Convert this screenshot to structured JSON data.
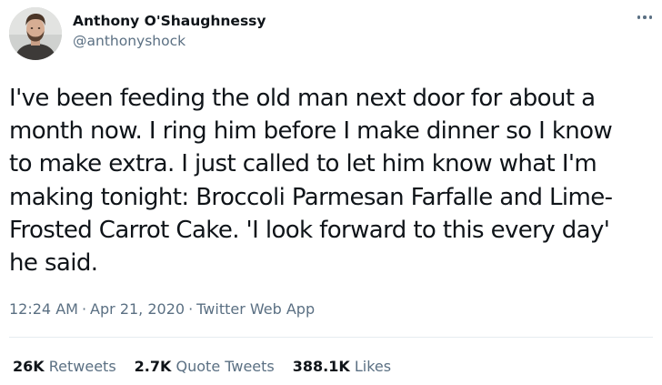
{
  "author": {
    "display_name": "Anthony O'Shaughnessy",
    "handle": "@anthonyshock",
    "avatar_icon": "profile-photo-avatar"
  },
  "more_icon": "more-options-icon",
  "tweet": {
    "lines": [
      "I've been feeding the old man next door for about a",
      "month now. I ring him before I make dinner so I know",
      "to make extra. I just called to let him know what I'm",
      "making tonight: Broccoli Parmesan Farfalle and Lime-",
      "Frosted Carrot Cake. 'I look forward to this every day'",
      "he said."
    ]
  },
  "meta": {
    "time": "12:24 AM",
    "separator": "·",
    "date": "Apr 21, 2020",
    "source": "Twitter Web App"
  },
  "stats": {
    "retweets": {
      "count": "26K",
      "label": "Retweets"
    },
    "quotes": {
      "count": "2.7K",
      "label": "Quote Tweets"
    },
    "likes": {
      "count": "388.1K",
      "label": "Likes"
    }
  },
  "colors": {
    "text": "#0f1419",
    "secondary": "#5b7083",
    "divider": "#e6ecf0"
  }
}
